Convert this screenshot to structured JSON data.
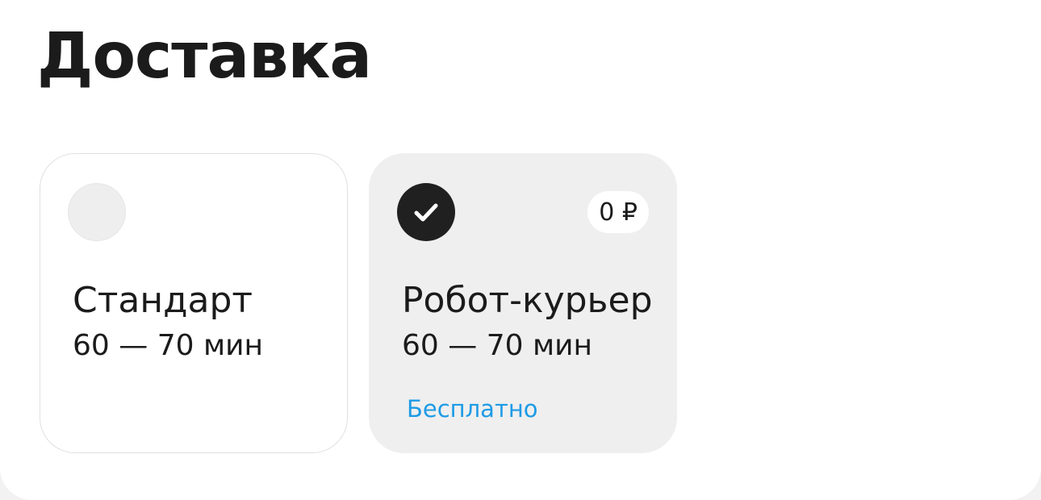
{
  "page": {
    "title": "Доставка"
  },
  "options": [
    {
      "title": "Стандарт",
      "time": "60 — 70 мин",
      "selected": false
    },
    {
      "title": "Робот-курьер",
      "time": "60 — 70 мин",
      "price": "0 ₽",
      "note": "Бесплатно",
      "selected": true
    }
  ],
  "colors": {
    "accent_link": "#1e9be6",
    "selected_card_bg": "#efefef",
    "check_bg": "#202020",
    "text": "#1b1b1b"
  },
  "icons": {
    "radio_unselected": "radio-empty-icon",
    "radio_selected": "checkmark-icon"
  }
}
